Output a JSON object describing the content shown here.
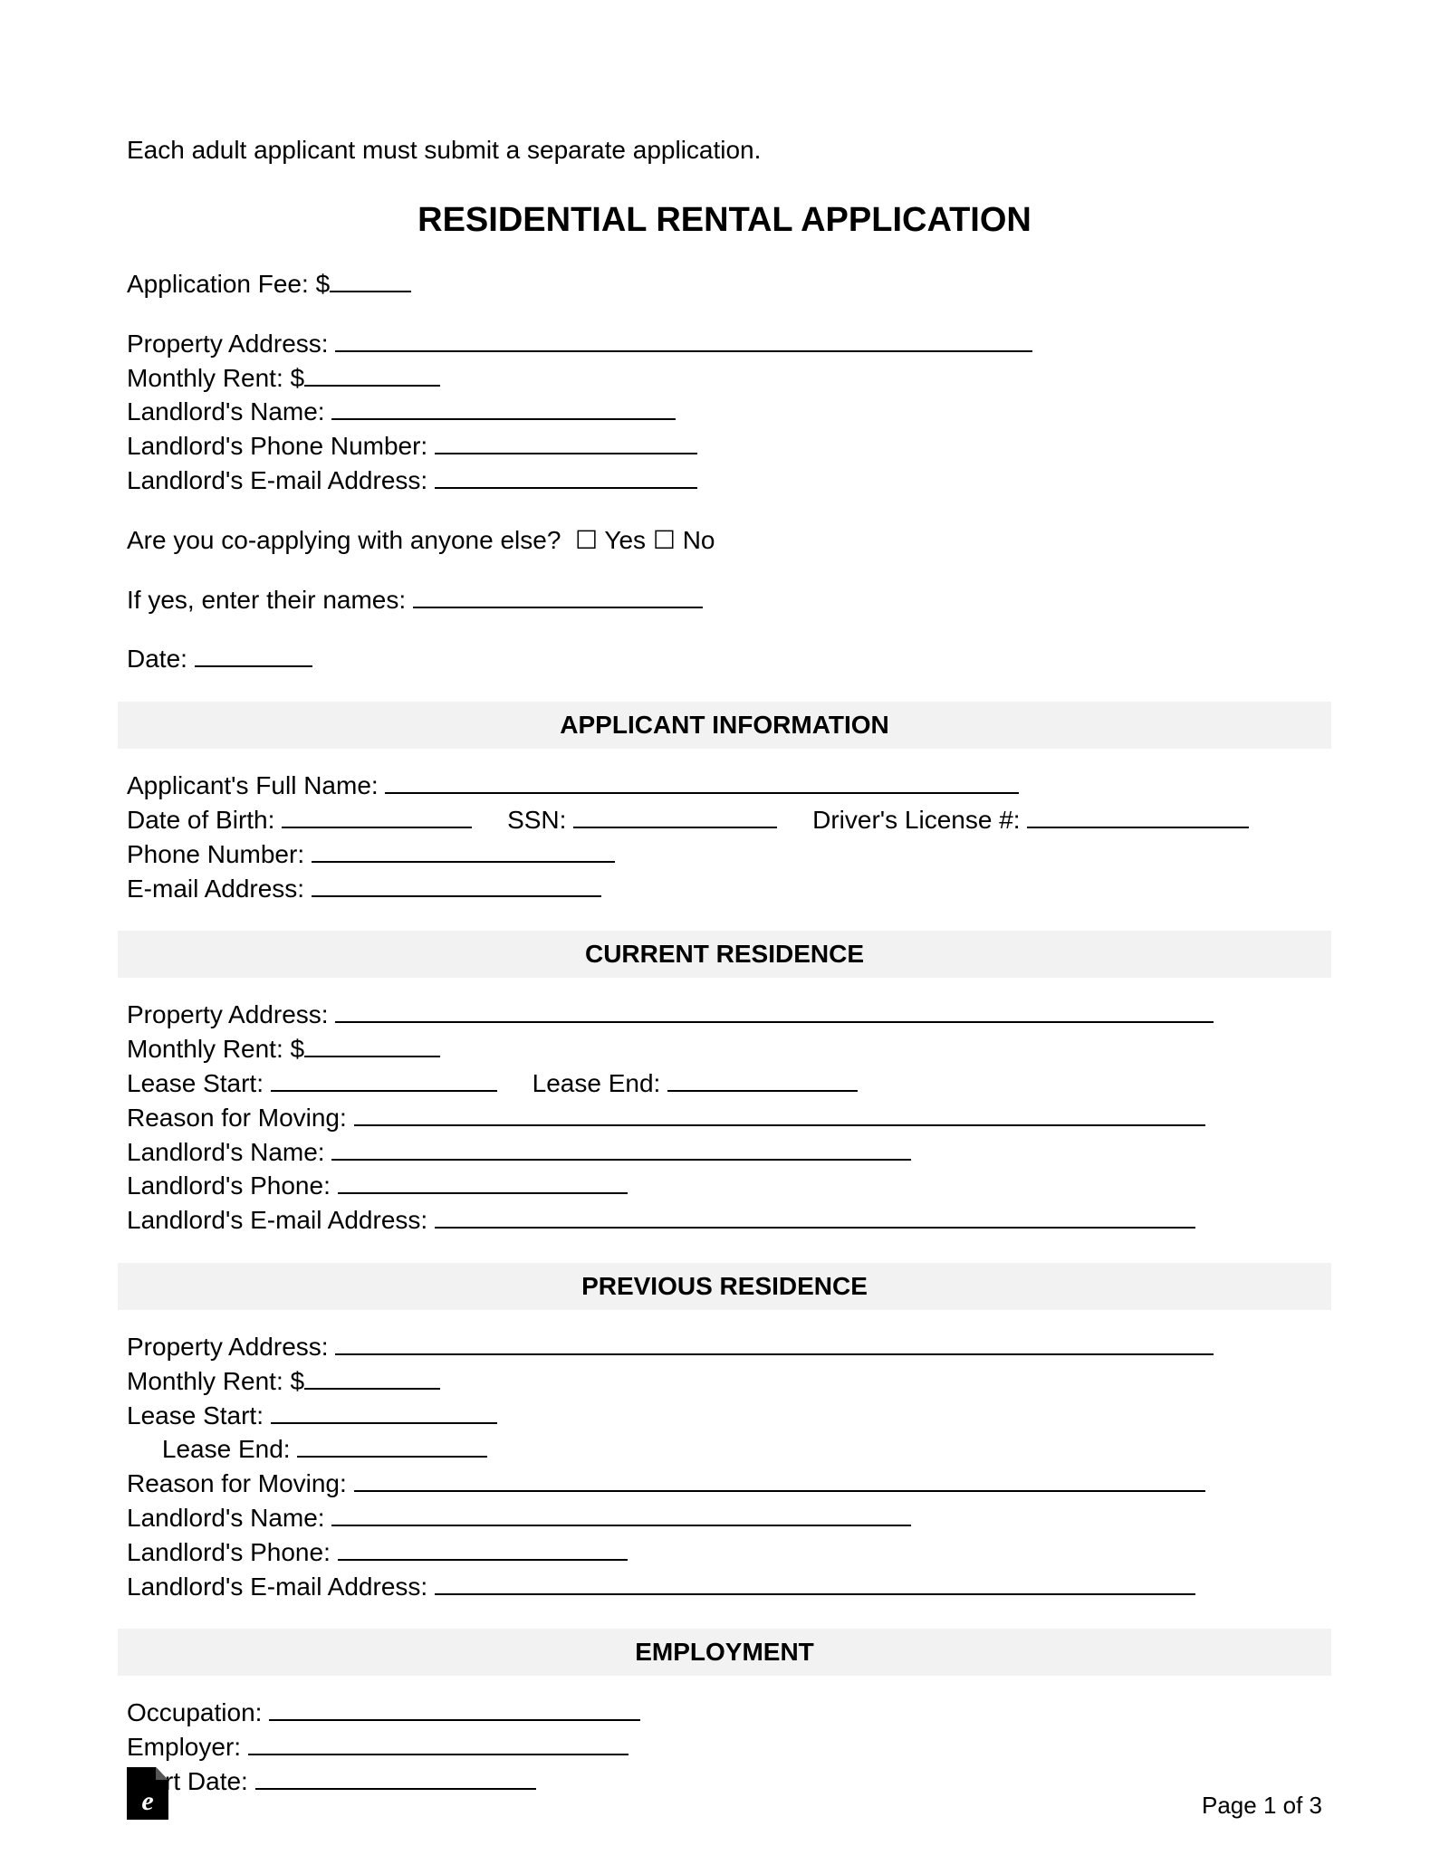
{
  "intro": "Each adult applicant must submit a separate application.",
  "title": "RESIDENTIAL RENTAL APPLICATION",
  "header": {
    "application_fee_label": "Application Fee: $",
    "property_address_label": "Property Address: ",
    "monthly_rent_label": "Monthly Rent: $",
    "landlord_name_label": "Landlord's Name: ",
    "landlord_phone_label": "Landlord's Phone Number: ",
    "landlord_email_label": "Landlord's E-mail Address: ",
    "coapply_label": "Are you co-applying with anyone else?  ",
    "yes": " Yes ",
    "no": " No",
    "ifyes_label": "If yes, enter their names: ",
    "date_label": "Date: "
  },
  "sections": {
    "applicant": {
      "heading": "APPLICANT INFORMATION",
      "full_name_label": "Applicant's Full Name: ",
      "dob_label": "Date of Birth: ",
      "ssn_label": "     SSN: ",
      "dl_label": "     Driver's License #: ",
      "phone_label": "Phone Number: ",
      "email_label": "E-mail Address: "
    },
    "current": {
      "heading": "CURRENT RESIDENCE",
      "property_address_label": "Property Address: ",
      "monthly_rent_label": "Monthly Rent: $",
      "lease_start_label": "Lease Start: ",
      "lease_end_label": "     Lease End: ",
      "reason_label": "Reason for Moving: ",
      "landlord_name_label": "Landlord's Name: ",
      "landlord_phone_label": "Landlord's Phone: ",
      "landlord_email_label": "Landlord's E-mail Address: "
    },
    "previous": {
      "heading": "PREVIOUS RESIDENCE",
      "property_address_label": "Property Address: ",
      "monthly_rent_label": "Monthly Rent: $",
      "lease_start_label": "Lease Start: ",
      "lease_end_label": "     Lease End: ",
      "reason_label": "Reason for Moving: ",
      "landlord_name_label": "Landlord's Name: ",
      "landlord_phone_label": "Landlord's Phone: ",
      "landlord_email_label": "Landlord's E-mail Address: "
    },
    "employment": {
      "heading": "EMPLOYMENT",
      "occupation_label": "Occupation: ",
      "employer_label": "Employer: ",
      "start_date_label": "Start Date: "
    }
  },
  "footer": {
    "logo_letter": "e",
    "page_label": "Page 1 of 3"
  }
}
